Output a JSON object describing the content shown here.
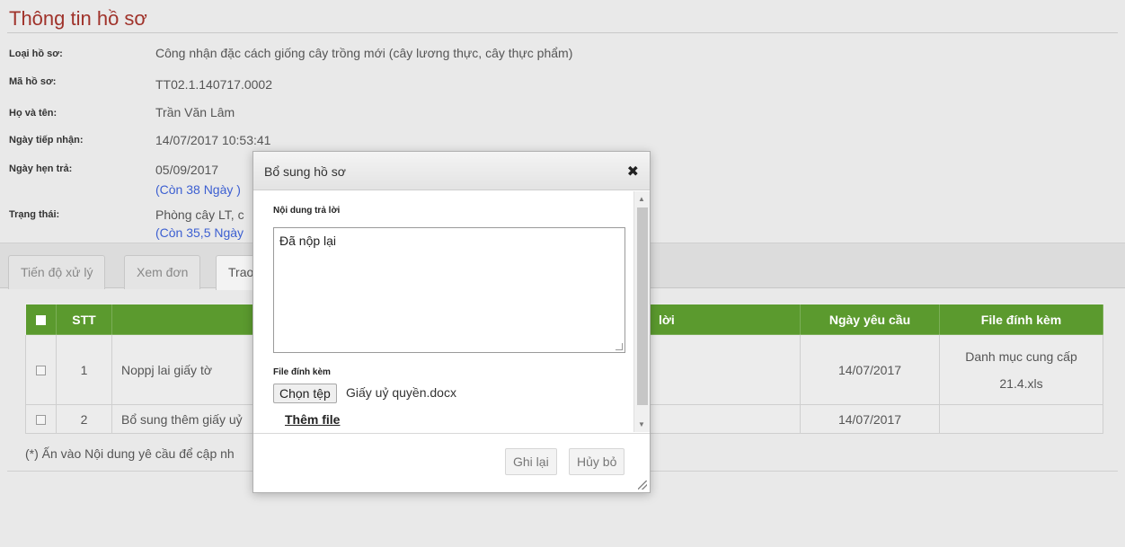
{
  "page": {
    "title": "Thông tin hồ sơ",
    "info": {
      "loai_label": "Loại hồ sơ:",
      "loai_value": "Công nhận đặc cách giống cây trồng mới (cây lương thực, cây thực phẩm)",
      "ma_label": "Mã hồ sơ:",
      "ma_value": "TT02.1.140717.0002",
      "hoten_label": "Họ và tên:",
      "hoten_value": "Trần Văn Lâm",
      "tiepnhan_label": "Ngày tiếp nhận:",
      "tiepnhan_value": "14/07/2017 10:53:41",
      "hentra_label": "Ngày hẹn trả:",
      "hentra_value": "05/09/2017",
      "hentra_sub": "(Còn 38 Ngày )",
      "trangthai_label": "Trạng thái:",
      "trangthai_value": "Phòng cây LT, c",
      "trangthai_sub": "(Còn 35,5 Ngày"
    }
  },
  "tabs": [
    {
      "label": "Tiến độ xử lý"
    },
    {
      "label": "Xem đơn"
    },
    {
      "label": "Trao"
    }
  ],
  "table": {
    "headers": {
      "stt": "STT",
      "content": "",
      "answer": "lời",
      "date": "Ngày yêu cầu",
      "file": "File đính kèm"
    },
    "rows": [
      {
        "stt": "1",
        "content": "Noppj lai giấy tờ",
        "date": "14/07/2017",
        "file_line1": "Danh mục cung cấp",
        "file_line2": "21.4.xls"
      },
      {
        "stt": "2",
        "content": "Bổ sung thêm giấy uỷ",
        "date": "14/07/2017",
        "file_line1": "",
        "file_line2": ""
      }
    ]
  },
  "footnote": "(*) Ấn vào Nội dung yê cầu để cập nh",
  "modal": {
    "title": "Bổ sung hồ sơ",
    "close": "✖",
    "content_label": "Nội dung trả lời",
    "content_value": "Đã nộp lại",
    "file_label": "File đính kèm",
    "choose_file": "Chọn tệp",
    "file_name": "Giấy uỷ quyền.docx",
    "add_file": "Thêm file",
    "save": "Ghi lại",
    "cancel": "Hủy bỏ"
  }
}
